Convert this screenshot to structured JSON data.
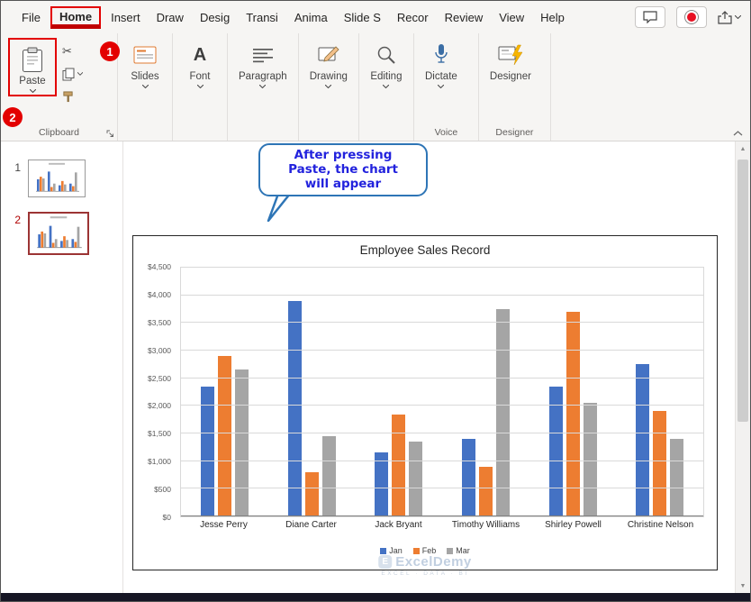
{
  "menubar": {
    "tabs": [
      {
        "id": "file",
        "label": "File"
      },
      {
        "id": "home",
        "label": "Home",
        "active": true
      },
      {
        "id": "insert",
        "label": "Insert"
      },
      {
        "id": "draw",
        "label": "Draw"
      },
      {
        "id": "design",
        "label": "Desig"
      },
      {
        "id": "transitions",
        "label": "Transi"
      },
      {
        "id": "animations",
        "label": "Anima"
      },
      {
        "id": "slideshow",
        "label": "Slide S"
      },
      {
        "id": "record",
        "label": "Recor"
      },
      {
        "id": "review",
        "label": "Review"
      },
      {
        "id": "view",
        "label": "View"
      },
      {
        "id": "help",
        "label": "Help"
      }
    ]
  },
  "ribbon": {
    "paste_label": "Paste",
    "buttons": [
      {
        "label": "Slides"
      },
      {
        "label": "Font"
      },
      {
        "label": "Paragraph"
      },
      {
        "label": "Drawing"
      },
      {
        "label": "Editing"
      },
      {
        "label": "Dictate"
      },
      {
        "label": "Designer"
      }
    ],
    "captions": {
      "clipboard": "Clipboard",
      "voice": "Voice",
      "designer": "Designer"
    }
  },
  "annotations": {
    "step1": "1",
    "step2": "2"
  },
  "slide_panel": {
    "slides": [
      {
        "number": "1"
      },
      {
        "number": "2",
        "selected": true
      }
    ]
  },
  "callout": {
    "line1": "After pressing",
    "line2": "Paste, the chart",
    "line3": "will appear"
  },
  "watermark": {
    "brand": "ExcelDemy",
    "tagline": "EXCEL · DATA · BI"
  },
  "chart_data": {
    "type": "bar",
    "title": "Employee Sales Record",
    "categories": [
      "Jesse Perry",
      "Diane Carter",
      "Jack Bryant",
      "Timothy Williams",
      "Shirley Powell",
      "Christine Nelson"
    ],
    "series": [
      {
        "name": "Jan",
        "color": "#4472C4",
        "values": [
          2350,
          3900,
          1150,
          1400,
          2350,
          2750
        ]
      },
      {
        "name": "Feb",
        "color": "#ED7D31",
        "values": [
          2900,
          800,
          1850,
          900,
          3700,
          1900
        ]
      },
      {
        "name": "Mar",
        "color": "#A5A5A5",
        "values": [
          2650,
          1450,
          1350,
          3750,
          2050,
          1400
        ]
      }
    ],
    "ylim": [
      0,
      4500
    ],
    "ytick_step": 500,
    "y_tick_prefix": "$",
    "grid": true,
    "legend_position": "bottom"
  }
}
